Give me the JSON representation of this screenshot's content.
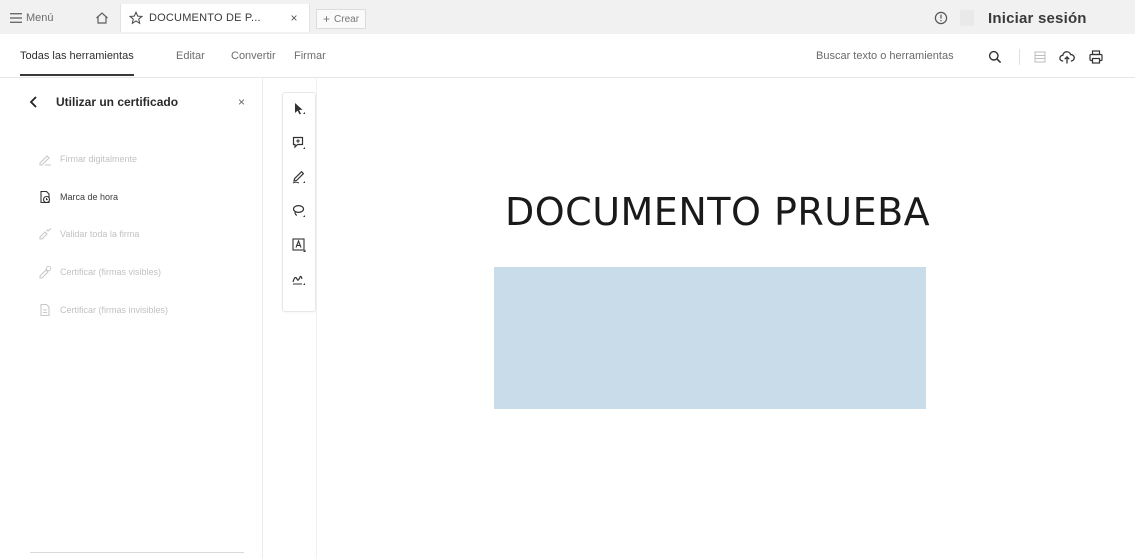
{
  "window": {
    "menu_label": "Menú",
    "tab_title": "DOCUMENTO DE P...",
    "tab_close": "×",
    "new_tab_label": "Crear",
    "signin_label": "Iniciar sesión"
  },
  "toolbar": {
    "tabs": [
      {
        "label": "Todas las herramientas",
        "active": true
      },
      {
        "label": "Editar",
        "active": false
      },
      {
        "label": "Convertir",
        "active": false
      },
      {
        "label": "Firmar",
        "active": false
      }
    ],
    "search_label": "Buscar texto o herramientas"
  },
  "left_panel": {
    "title": "Utilizar un certificado",
    "close": "×",
    "items": [
      {
        "label": "Firmar digitalmente",
        "enabled": false
      },
      {
        "label": "Marca de hora",
        "enabled": true
      },
      {
        "label": "Validar toda la firma",
        "enabled": false
      },
      {
        "label": "Certificar (firmas visibles)",
        "enabled": false
      },
      {
        "label": "Certificar (firmas invisibles)",
        "enabled": false
      }
    ]
  },
  "tool_strip": {
    "icons": [
      "select-arrow-icon",
      "comment-icon",
      "pen-icon",
      "lasso-icon",
      "text-box-icon",
      "signature-icon"
    ]
  },
  "document": {
    "heading": "DOCUMENTO PRUEBA",
    "rect_color": "#c8dce9"
  },
  "colors": {
    "tab_bar_bg": "#f1f1f1",
    "disabled_text": "#c2c2c2",
    "text": "#2c2c2c"
  }
}
